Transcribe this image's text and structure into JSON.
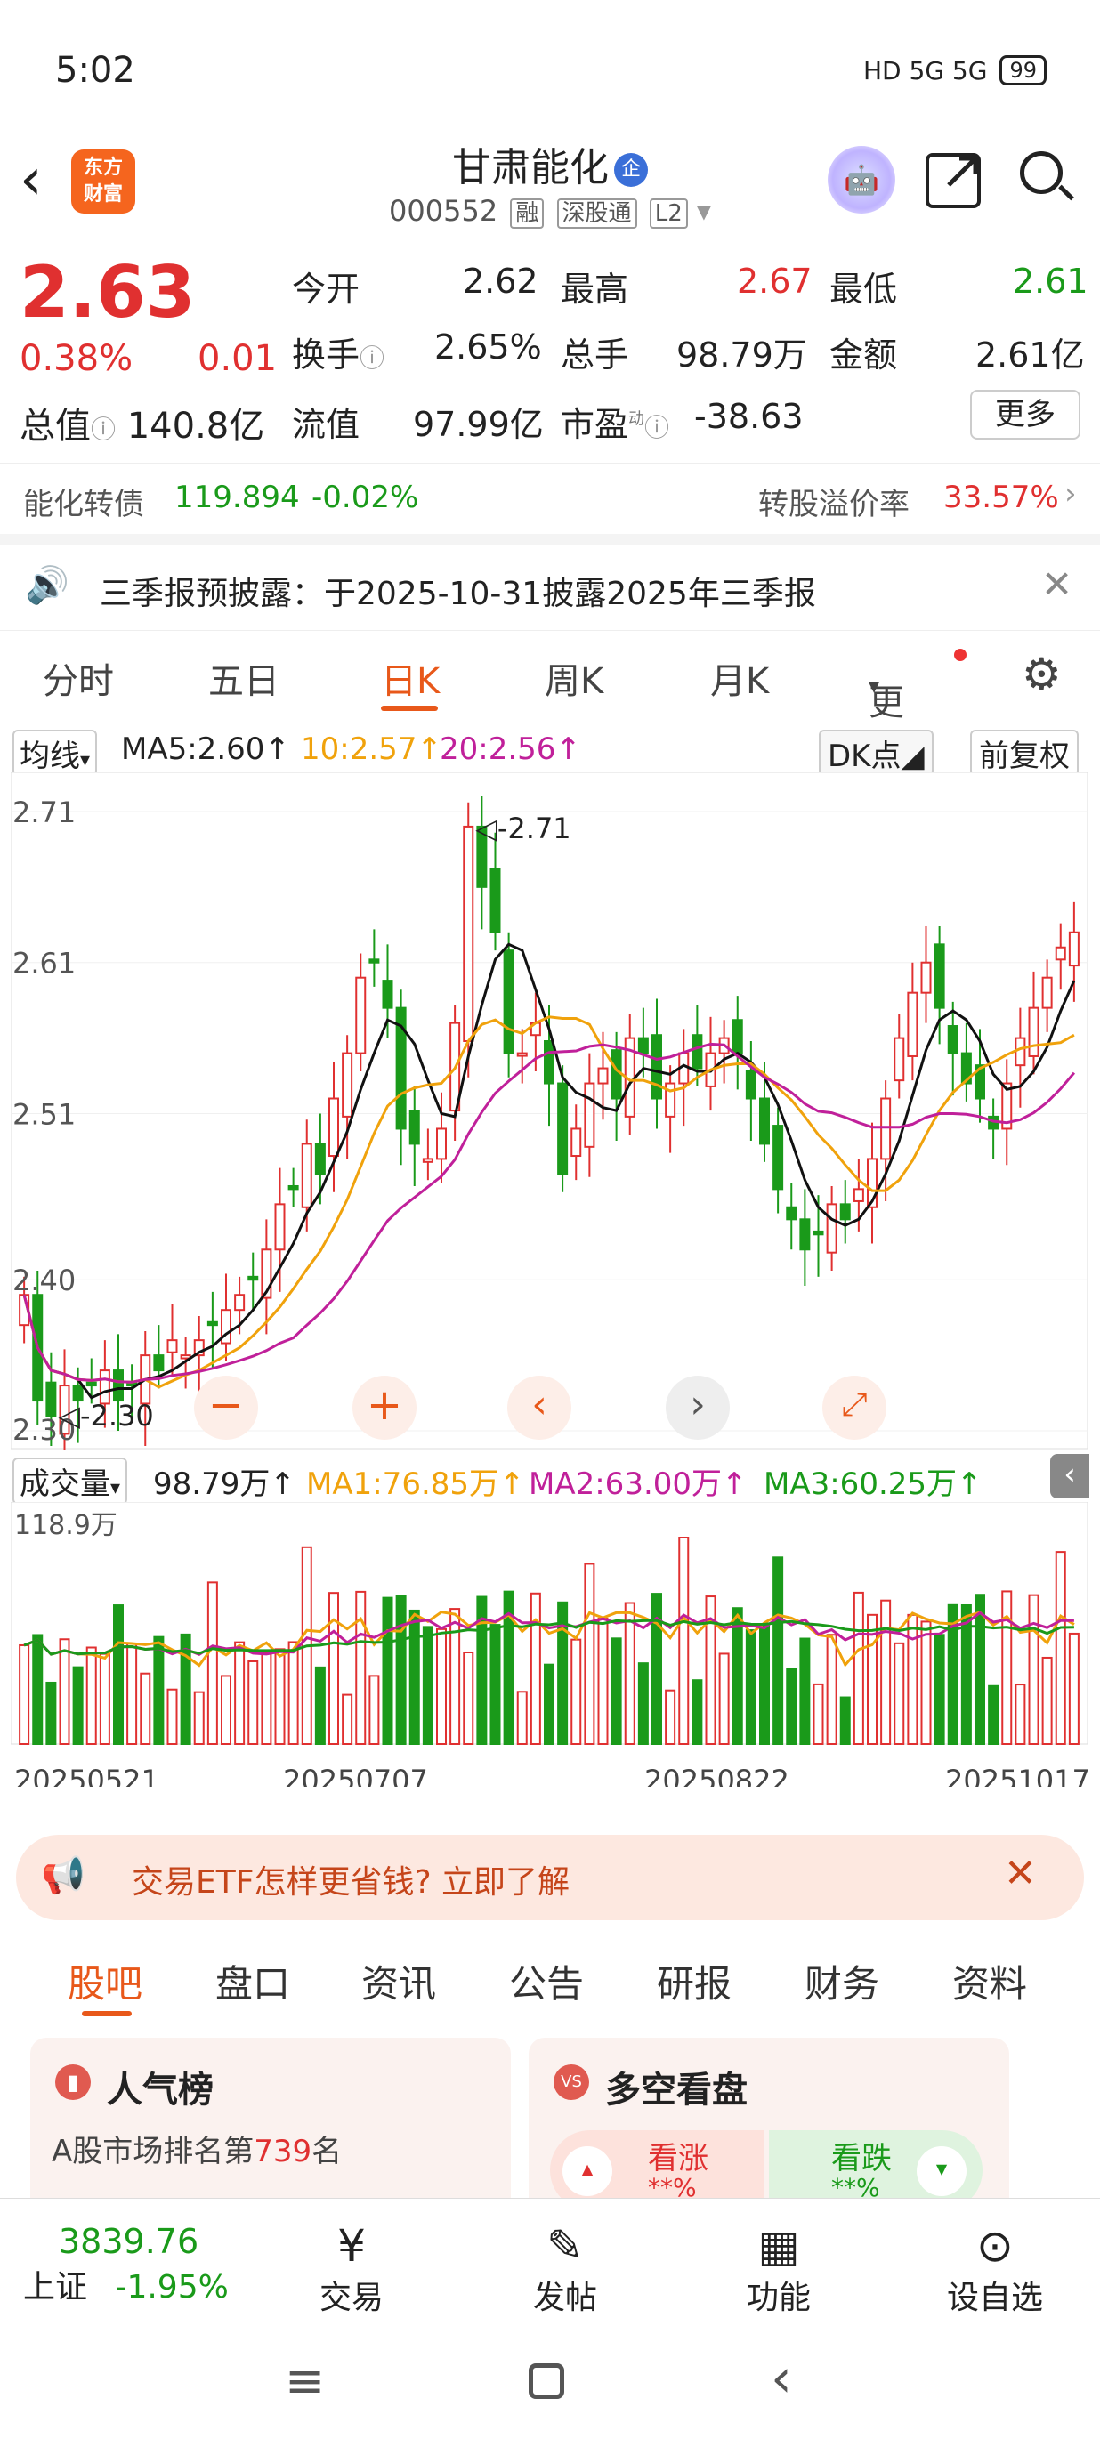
{
  "status": {
    "time": "5:02",
    "signal": "HD 5G 5G",
    "battery": "99"
  },
  "header": {
    "logo": "东方财富",
    "name": "甘肃能化",
    "name_badge": "企",
    "code": "000552",
    "tags": [
      "融",
      "深股通",
      "L2"
    ]
  },
  "quote": {
    "price": "2.63",
    "change_pct": "0.38%",
    "change": "0.01",
    "open_l": "今开",
    "open": "2.62",
    "high_l": "最高",
    "high": "2.67",
    "low_l": "最低",
    "low": "2.61",
    "turn_l": "换手",
    "turn": "2.65%",
    "vol_l": "总手",
    "vol": "98.79万",
    "amt_l": "金额",
    "amt": "2.61亿",
    "mcap_l": "总值",
    "mcap": "140.8亿",
    "float_l": "流值",
    "float": "97.99亿",
    "pe_l": "市盈",
    "pe_sup": "动",
    "pe": "-38.63",
    "more": "更多"
  },
  "conv": {
    "name": "能化转债",
    "price": "119.894",
    "chg": "-0.02%",
    "prem_l": "转股溢价率",
    "prem": "33.57%"
  },
  "notice": {
    "text": "三季报预披露：于2025-10-31披露2025年三季报"
  },
  "tabs": [
    "分时",
    "五日",
    "日K",
    "周K",
    "月K",
    "更多"
  ],
  "chart": {
    "ma_sel": "均线",
    "ma5": "MA5:2.60",
    "ma10": "10:2.57",
    "ma20": "20:2.56",
    "dk": "DK点",
    "adj": "前复权",
    "y_labels": [
      "2.71",
      "2.61",
      "2.51",
      "2.40",
      "2.30"
    ],
    "hi_note": "2.71",
    "lo_note": "2.30"
  },
  "vol": {
    "sel": "成交量",
    "val": "98.79万",
    "ma1": "MA1:76.85万",
    "ma2": "MA2:63.00万",
    "ma3": "MA3:60.25万",
    "max": "118.9万",
    "dates": [
      "20250521",
      "20250707",
      "20250822",
      "20251017"
    ]
  },
  "ad": {
    "text": "交易ETF怎样更省钱? 立即了解"
  },
  "subtabs": [
    "股吧",
    "盘口",
    "资讯",
    "公告",
    "研报",
    "财务",
    "资料"
  ],
  "cards": {
    "pop_title": "人气榜",
    "pop_line1": "A股市场排名第",
    "pop_rank": "739",
    "pop_unit": "名",
    "ls_title": "多空看盘",
    "up": "看涨",
    "down": "看跌",
    "mask": "**%"
  },
  "bottom": {
    "index_val": "3839.76",
    "index_name": "上证",
    "index_chg": "-1.95%",
    "trade": "交易",
    "post": "发帖",
    "func": "功能",
    "watch": "设自选"
  },
  "colors": {
    "up": "#e03030",
    "down": "#1a9a1a",
    "accent": "#e8581a",
    "ma5": "#111111",
    "ma10": "#f0a20c",
    "ma20": "#c0209a"
  },
  "chart_data": {
    "type": "candlestick",
    "ylim": [
      2.3,
      2.73
    ],
    "closes": [
      2.39,
      2.32,
      2.31,
      2.33,
      2.32,
      2.33,
      2.34,
      2.32,
      2.33,
      2.35,
      2.34,
      2.36,
      2.35,
      2.36,
      2.37,
      2.38,
      2.39,
      2.4,
      2.42,
      2.45,
      2.46,
      2.49,
      2.47,
      2.52,
      2.55,
      2.6,
      2.61,
      2.58,
      2.5,
      2.49,
      2.48,
      2.5,
      2.57,
      2.7,
      2.66,
      2.63,
      2.55,
      2.55,
      2.57,
      2.53,
      2.47,
      2.5,
      2.53,
      2.54,
      2.52,
      2.56,
      2.55,
      2.52,
      2.53,
      2.55,
      2.54,
      2.55,
      2.56,
      2.55,
      2.52,
      2.49,
      2.46,
      2.44,
      2.42,
      2.43,
      2.45,
      2.44,
      2.46,
      2.48,
      2.52,
      2.56,
      2.59,
      2.61,
      2.58,
      2.55,
      2.53,
      2.52,
      2.5,
      2.53,
      2.56,
      2.58,
      2.6,
      2.62,
      2.63
    ]
  }
}
